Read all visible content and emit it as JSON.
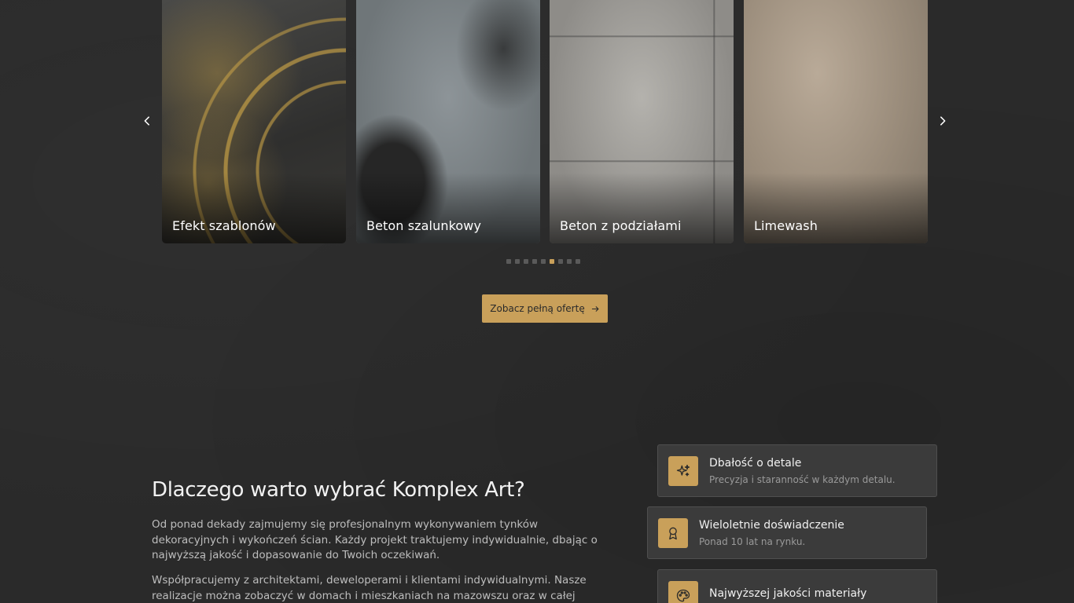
{
  "carousel": {
    "cards": [
      {
        "label": "Efekt szablonów"
      },
      {
        "label": "Beton szalunkowy"
      },
      {
        "label": "Beton z podziałami"
      },
      {
        "label": "Limewash"
      }
    ],
    "dots_total": 9,
    "dots_active_index": 5,
    "prev_icon": "chevron-left-icon",
    "next_icon": "chevron-right-icon"
  },
  "cta": {
    "label": "Zobacz pełną ofertę",
    "icon": "arrow-right-icon"
  },
  "why": {
    "title": "Dlaczego warto wybrać Komplex Art?",
    "p1": "Od ponad dekady zajmujemy się profesjonalnym wykonywaniem tynków dekoracyjnych i wykończeń ścian. Każdy projekt traktujemy indywidualnie, dbając o najwyższą jakość i dopasowanie do Twoich oczekiwań.",
    "p2": "Współpracujemy z architektami, deweloperami i klientami indywidualnymi. Nasze realizacje można zobaczyć w domach i mieszkaniach na mazowszu oraz w całej Polsce."
  },
  "features": [
    {
      "title": "Dbałość o detale",
      "desc": "Precyzja i staranność w każdym detalu.",
      "icon": "sparkles-icon"
    },
    {
      "title": "Wieloletnie doświadczenie",
      "desc": "Ponad 10 lat na rynku.",
      "icon": "award-icon"
    },
    {
      "title": "Najwyższej jakości materiały",
      "desc": "",
      "icon": "palette-icon"
    }
  ],
  "colors": {
    "background": "#2a2a2a",
    "accent": "#c9a05a",
    "card_bg": "#3b3b3b"
  }
}
